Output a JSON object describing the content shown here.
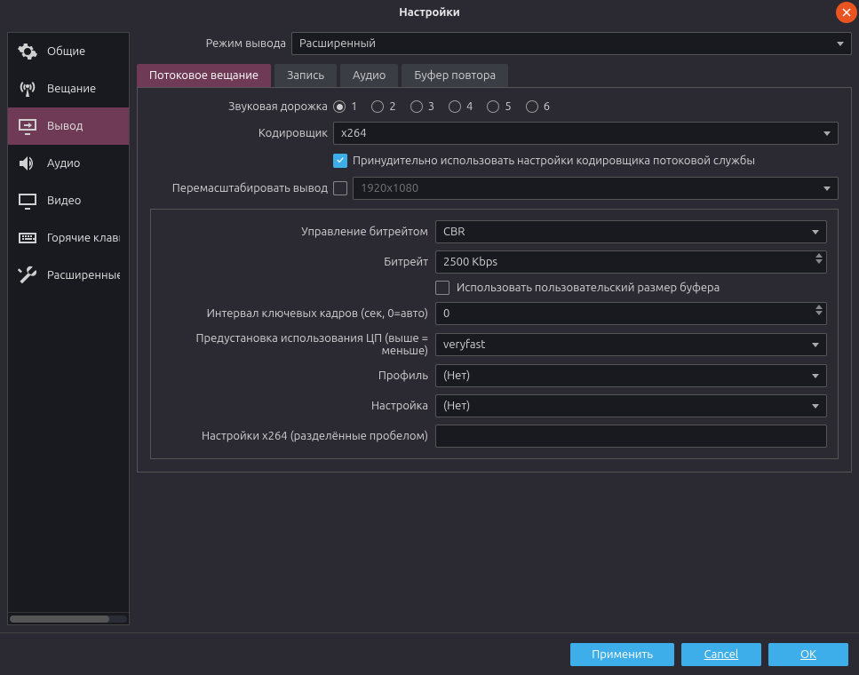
{
  "title": "Настройки",
  "sidebar": {
    "items": [
      {
        "label": "Общие"
      },
      {
        "label": "Вещание"
      },
      {
        "label": "Вывод"
      },
      {
        "label": "Аудио"
      },
      {
        "label": "Видео"
      },
      {
        "label": "Горячие клавиши"
      },
      {
        "label": "Расширенные"
      }
    ]
  },
  "output_mode": {
    "label": "Режим вывода",
    "value": "Расширенный"
  },
  "tabs": [
    {
      "label": "Потоковое вещание"
    },
    {
      "label": "Запись"
    },
    {
      "label": "Аудио"
    },
    {
      "label": "Буфер повтора"
    }
  ],
  "audio_track": {
    "label": "Звуковая дорожка",
    "options": [
      "1",
      "2",
      "3",
      "4",
      "5",
      "6"
    ],
    "selected": "1"
  },
  "encoder": {
    "label": "Кодировщик",
    "value": "x264"
  },
  "enforce": {
    "label": "Принудительно использовать настройки кодировщика потоковой службы",
    "checked": true
  },
  "rescale": {
    "label": "Перемасштабировать вывод",
    "checked": false,
    "value": "1920x1080"
  },
  "rate_control": {
    "label": "Управление битрейтом",
    "value": "CBR"
  },
  "bitrate": {
    "label": "Битрейт",
    "value": "2500 Kbps"
  },
  "custom_buffer": {
    "label": "Использовать пользовательский размер буфера",
    "checked": false
  },
  "keyint": {
    "label": "Интервал ключевых кадров (сек, 0=авто)",
    "value": "0"
  },
  "preset": {
    "label": "Предустановка использования ЦП (выше = меньше)",
    "value": "veryfast"
  },
  "profile": {
    "label": "Профиль",
    "value": "(Нет)"
  },
  "tune": {
    "label": "Настройка",
    "value": "(Нет)"
  },
  "x264opts": {
    "label": "Настройки x264 (разделённые пробелом)",
    "value": ""
  },
  "footer": {
    "apply": "Применить",
    "cancel": "Cancel",
    "ok": "OK"
  }
}
